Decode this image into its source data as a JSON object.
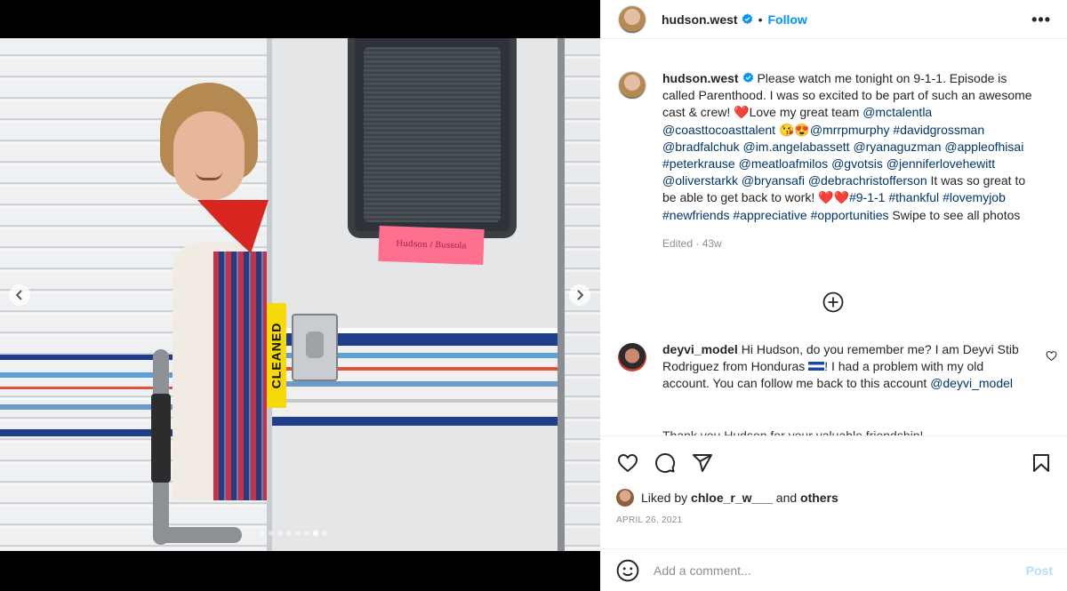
{
  "media": {
    "door_sign": "CLEANED",
    "note_text": "Hudson / Bussola",
    "carousel": {
      "total": 8,
      "active_index": 6
    }
  },
  "header": {
    "username": "hudson.west",
    "separator": "•",
    "follow_label": "Follow",
    "more_label": "•••"
  },
  "caption": {
    "username": "hudson.west",
    "text_1": " Please watch me tonight on 9-1-1. Episode is called Parenthood. I was so excited to be part of such an awesome cast & crew! ",
    "heart_1": "❤️",
    "text_2": "Love my great team ",
    "mentions_1": [
      "@mctalentla",
      "@coasttocoasttalent"
    ],
    "emojis_1": "😘😍",
    "mentions_2": [
      "@mrrpmurphy",
      "#davidgrossman",
      "@bradfalchuk",
      "@im.angelabassett",
      "@ryanaguzman",
      "@appleofhisai",
      "#peterkrause",
      "@meatloafmilos",
      "@gvotsis",
      "@jenniferlovehewitt",
      "@oliverstarkk",
      "@bryansafi",
      "@debrachristofferson"
    ],
    "text_3": " It was so great to be able to get back to work! ",
    "hearts_2": "❤️❤️",
    "tags": [
      "#9-1-1",
      "#thankful",
      "#lovemyjob",
      "#newfriends",
      "#appreciative",
      "#opportunities"
    ],
    "text_4": " Swipe to see all photos",
    "edited": "Edited · 43w"
  },
  "comment": {
    "username": "deyvi_model",
    "text_1": " Hi Hudson, do you remember me? I am Deyvi Stib Rodriguez from Honduras ",
    "text_2": "! I had a problem with my old account. You can follow me back to this account ",
    "mention": "@deyvi_model",
    "partial_next_line": "Thank you Hudson for your valuable friendship!"
  },
  "actions": {
    "liked_by_prefix": "Liked by ",
    "liked_by_user": "chloe_r_w___",
    "liked_by_mid": " and ",
    "liked_by_others": "others",
    "date": "APRIL 26, 2021"
  },
  "add_comment": {
    "placeholder": "Add a comment...",
    "post_label": "Post"
  },
  "colors": {
    "accent": "#0095f6",
    "link": "#00376b",
    "muted": "#8e8e8e",
    "post_disabled": "#b2dffc",
    "heart": "#e0245e"
  },
  "icons": [
    "verified-badge-icon",
    "plus-circle-icon",
    "heart-icon",
    "comment-icon",
    "share-icon",
    "bookmark-icon",
    "emoji-icon",
    "chevron-left-icon",
    "chevron-right-icon"
  ]
}
